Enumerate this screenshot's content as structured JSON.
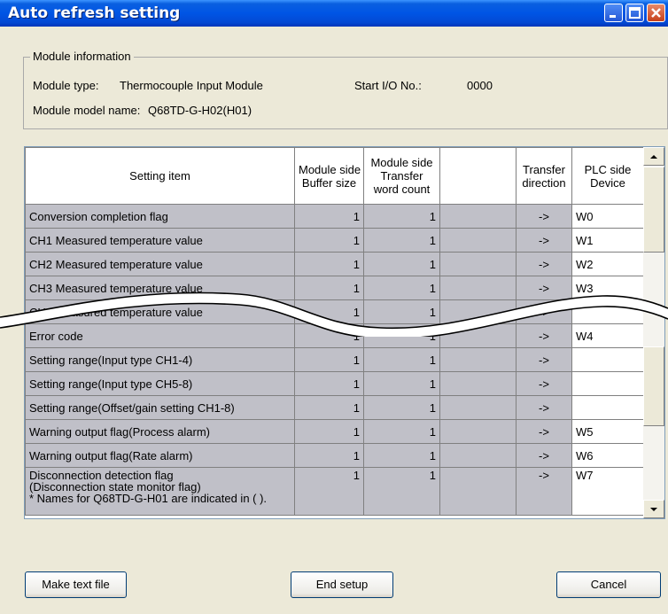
{
  "window": {
    "title": "Auto refresh setting"
  },
  "module_info": {
    "group_label": "Module information",
    "type_label": "Module type:",
    "type_value": "Thermocouple Input Module",
    "start_io_label": "Start I/O No.:",
    "start_io_value": "0000",
    "model_label": "Module model name:",
    "model_value": "Q68TD-G-H02(H01)"
  },
  "grid": {
    "headers": {
      "setting_item": "Setting item",
      "buffer_line1": "Module side",
      "buffer_line2": "Buffer size",
      "transfer_line1": "Module side",
      "transfer_line2": "Transfer",
      "transfer_line3": "word count",
      "blank": "",
      "direction_line1": "Transfer",
      "direction_line2": "direction",
      "plc_line1": "PLC side",
      "plc_line2": "Device"
    },
    "rows": [
      {
        "item": "Conversion completion flag",
        "buffer": "1",
        "words": "1",
        "dir": "->",
        "device": "W0"
      },
      {
        "item": "CH1 Measured temperature value",
        "buffer": "1",
        "words": "1",
        "dir": "->",
        "device": "W1"
      },
      {
        "item": "CH2 Measured temperature value",
        "buffer": "1",
        "words": "1",
        "dir": "->",
        "device": "W2"
      },
      {
        "item": "CH3 Measured temperature value",
        "buffer": "1",
        "words": "1",
        "dir": "->",
        "device": "W3"
      },
      {
        "item": "CH4 Measured temperature value",
        "buffer": "1",
        "words": "1",
        "dir": "->",
        "device": ""
      },
      {
        "item": "Error code",
        "buffer": "1",
        "words": "1",
        "dir": "->",
        "device": "W4"
      },
      {
        "item": "Setting range(Input type CH1-4)",
        "buffer": "1",
        "words": "1",
        "dir": "->",
        "device": ""
      },
      {
        "item": "Setting range(Input type CH5-8)",
        "buffer": "1",
        "words": "1",
        "dir": "->",
        "device": ""
      },
      {
        "item": "Setting range(Offset/gain setting CH1-8)",
        "buffer": "1",
        "words": "1",
        "dir": "->",
        "device": ""
      },
      {
        "item": "Warning output flag(Process alarm)",
        "buffer": "1",
        "words": "1",
        "dir": "->",
        "device": "W5"
      },
      {
        "item": "Warning output flag(Rate alarm)",
        "buffer": "1",
        "words": "1",
        "dir": "->",
        "device": "W6"
      }
    ],
    "last_row": {
      "item_line1": "Disconnection detection flag",
      "item_line2": "(Disconnection state monitor flag)",
      "item_line3": "* Names for Q68TD-G-H01 are indicated in ( ).",
      "buffer": "1",
      "words": "1",
      "dir": "->",
      "device": "W7"
    }
  },
  "buttons": {
    "make_text_file": "Make text file",
    "end_setup": "End setup",
    "cancel": "Cancel"
  },
  "colors": {
    "title_bar": "#0055e5",
    "disabled_cell": "#c0c0c8",
    "dialog_bg": "#ece9d8"
  }
}
